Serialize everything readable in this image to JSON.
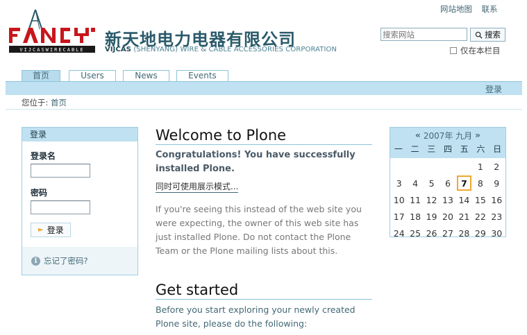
{
  "site_actions": {
    "sitemap": "网站地图",
    "contact": "联系"
  },
  "brand": {
    "logo_text": "FANCY",
    "logo_strip": "VIJCASWIRECABLE",
    "company_cn": "新天地电力电器有限公司",
    "company_en_bold": "VIJCAS",
    "company_en_rest": " (SHENYANG) WIRE & CABLE ACCESSORIES CORPORATION",
    "accent": "#2a5a6a",
    "logo_red": "#c8161d"
  },
  "search": {
    "placeholder": "搜索网站",
    "button_label": "搜索",
    "section_only_label": "仅在本栏目"
  },
  "tabs": [
    {
      "label": "首页",
      "active": true
    },
    {
      "label": "Users",
      "active": false
    },
    {
      "label": "News",
      "active": false
    },
    {
      "label": "Events",
      "active": false
    }
  ],
  "tabbar": {
    "login_label": "登录"
  },
  "breadcrumb": {
    "prefix": "您位于:",
    "current": "首页"
  },
  "login_portlet": {
    "title": "登录",
    "username_label": "登录名",
    "password_label": "密码",
    "submit_label": "登录",
    "forgot_label": "忘记了密码?"
  },
  "content": {
    "title": "Welcome to Plone",
    "congrats": "Congratulations! You have successfully installed Plone.",
    "presentation_link": "同时可使用展示模式...",
    "intro": "If you're seeing this instead of the web site you were expecting, the owner of this web site has just installed Plone. Do not contact the Plone Team or the Plone mailing lists about this.",
    "get_started_title": "Get started",
    "before": "Before you start exploring your newly created Plone site, please do the following:"
  },
  "calendar": {
    "prev": "«",
    "next": "»",
    "month_label": "2007年 九月",
    "weekdays": [
      "一",
      "二",
      "三",
      "四",
      "五",
      "六",
      "日"
    ],
    "leading_blanks": 5,
    "days_in_month": 30,
    "today": 7
  },
  "colors": {
    "tab_bar": "#bfe1f1",
    "link": "#436976",
    "today_border": "#f0a830"
  }
}
